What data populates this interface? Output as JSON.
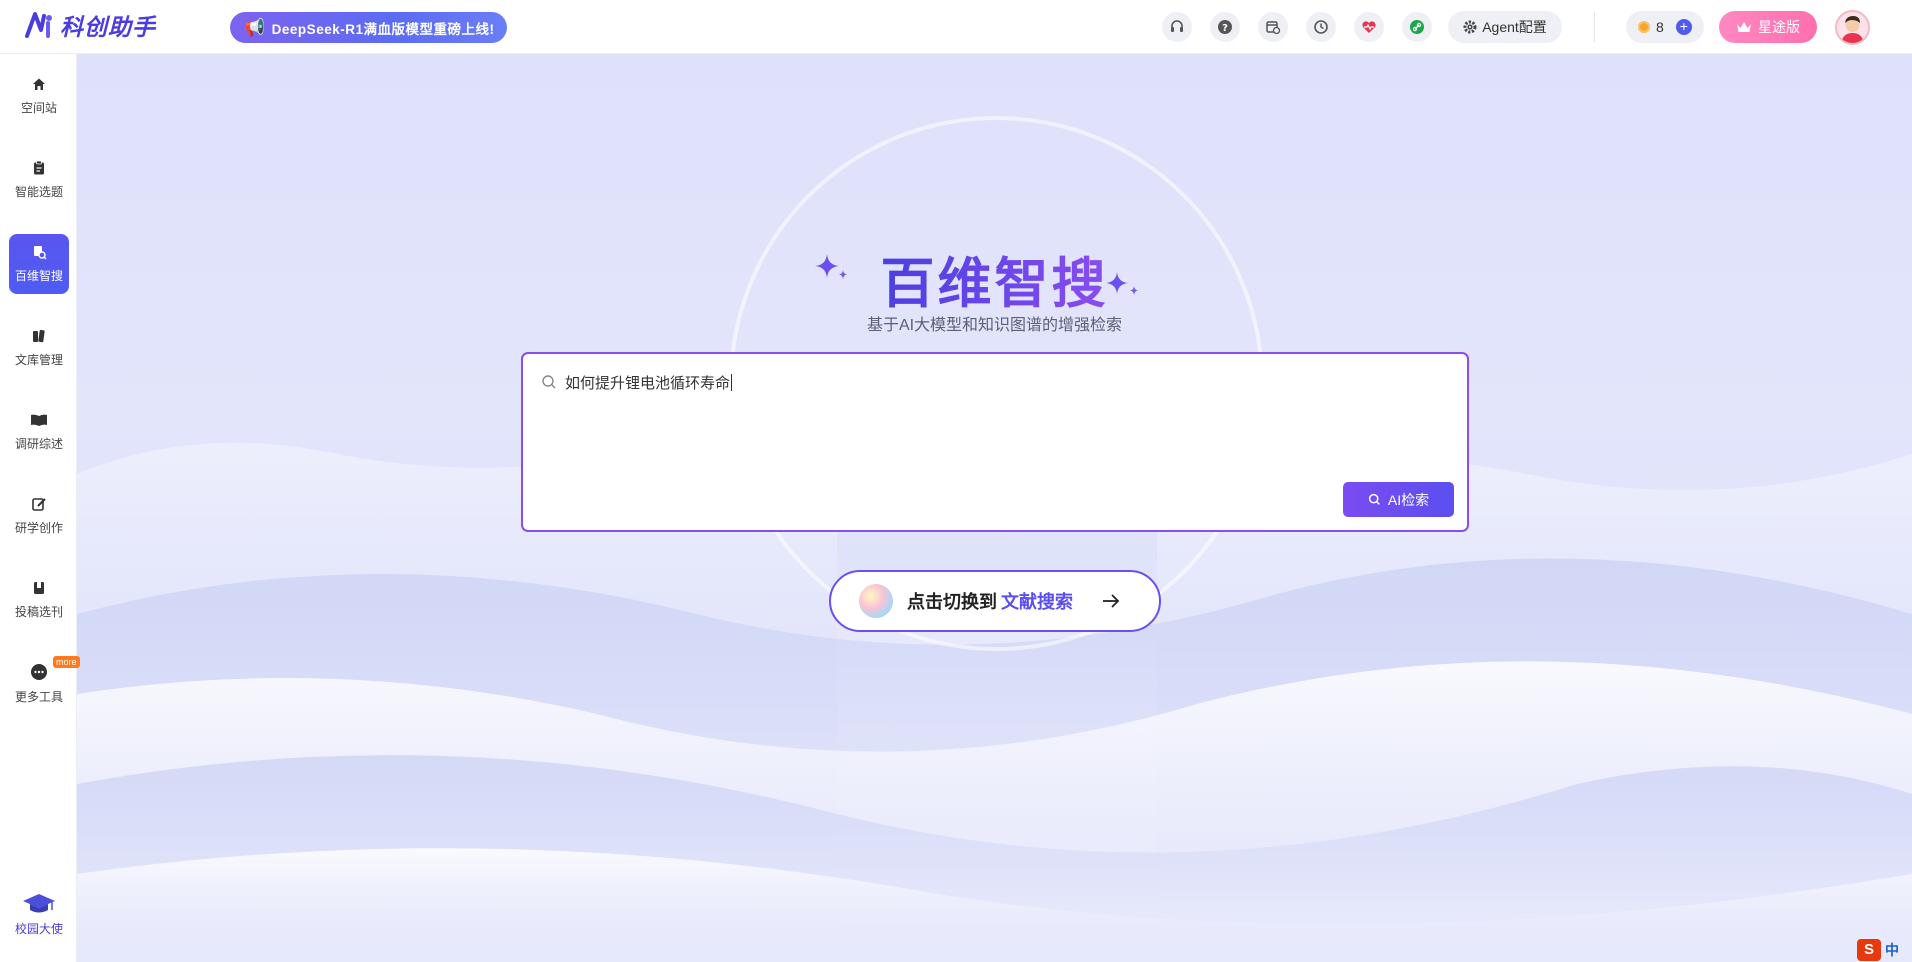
{
  "app": {
    "name": "科创助手",
    "promo_banner": "DeepSeek-R1满血版模型重磅上线!"
  },
  "header": {
    "icons": [
      "headset-icon",
      "help-icon",
      "calendar-clock-icon",
      "history-icon",
      "heart-rate-icon",
      "link-icon"
    ],
    "agent_label": "Agent配置",
    "coins": "8",
    "plus_label": "+",
    "vip_label": "星途版"
  },
  "sidebar": {
    "items": [
      {
        "label": "空间站",
        "icon": "home-icon"
      },
      {
        "label": "智能选题",
        "icon": "clipboard-icon"
      },
      {
        "label": "百维智搜",
        "icon": "search-doc-icon",
        "active": true
      },
      {
        "label": "文库管理",
        "icon": "books-icon"
      },
      {
        "label": "调研综述",
        "icon": "open-book-icon"
      },
      {
        "label": "研学创作",
        "icon": "edit-icon"
      },
      {
        "label": "投稿选刊",
        "icon": "journal-icon"
      },
      {
        "label": "更多工具",
        "icon": "more-icon",
        "badge": "more"
      }
    ],
    "ambassador_label": "校园大使"
  },
  "main": {
    "title": "百维智搜",
    "subtitle": "基于AI大模型和知识图谱的增强检索",
    "search": {
      "value": "如何提升锂电池循环寿命",
      "button_label": "AI检索"
    },
    "switch": {
      "prefix": "点击切换到",
      "highlight": "文献搜索"
    }
  },
  "ime": {
    "brand": "S",
    "mode": "中"
  },
  "colors": {
    "accent": "#5b4ff0",
    "accent_purple": "#8a4df0",
    "vip_pink": "#ff6fae"
  }
}
